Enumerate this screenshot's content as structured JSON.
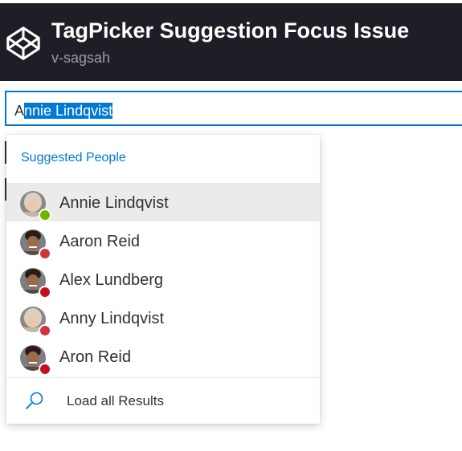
{
  "header": {
    "title": "TagPicker Suggestion Focus Issue",
    "author": "v-sagsah",
    "logo_icon": "codepen-logo-icon"
  },
  "picker": {
    "typed": "A",
    "autocomplete_selected": "nnie Lindqvist"
  },
  "suggestions": {
    "header": "Suggested People",
    "items": [
      {
        "name": "Annie Lindqvist",
        "presence": "online",
        "presence_color": "#6bb700",
        "avatar": "woman-avatar",
        "active": true
      },
      {
        "name": "Aaron Reid",
        "presence": "busy",
        "presence_color": "#d13438",
        "avatar": "man-avatar",
        "active": false
      },
      {
        "name": "Alex Lundberg",
        "presence": "dnd",
        "presence_color": "#c50f1f",
        "avatar": "man-avatar",
        "active": false
      },
      {
        "name": "Anny Lindqvist",
        "presence": "busy",
        "presence_color": "#d13438",
        "avatar": "woman-avatar",
        "active": false
      },
      {
        "name": "Aron Reid",
        "presence": "dnd",
        "presence_color": "#c50f1f",
        "avatar": "man-avatar",
        "active": false
      }
    ],
    "load_all": "Load all Results",
    "load_all_icon": "search-icon"
  },
  "colors": {
    "accent": "#0078d4",
    "header_bg": "#1e1f26",
    "active_item_bg": "#edebe9"
  }
}
